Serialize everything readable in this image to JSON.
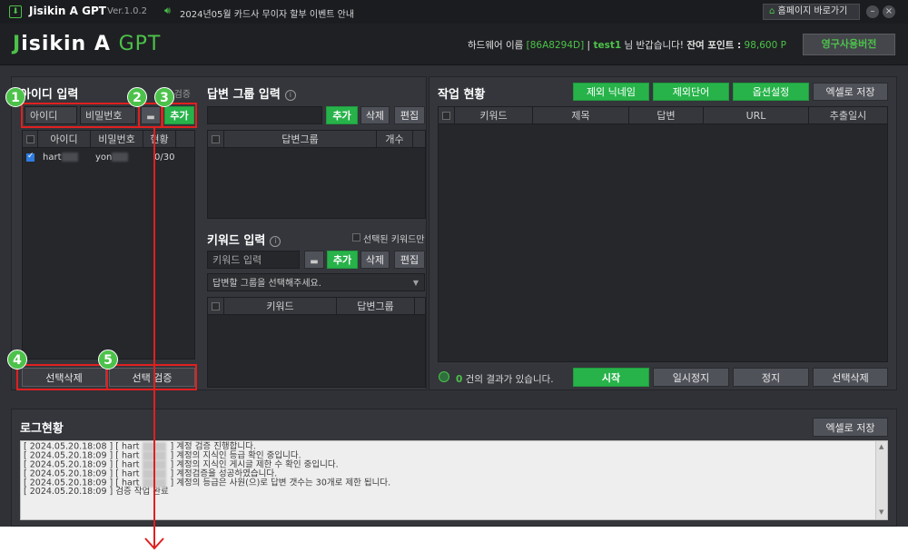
{
  "titlebar": {
    "app_name": "Jisikin A GPT",
    "version": "Ver.1.0.2",
    "notice": "2024년05월 카드사 무이자 할부 이벤트 안내",
    "home_button": "홈페이지 바로가기",
    "min": "–",
    "close": "×"
  },
  "header": {
    "logo_j": "J",
    "logo_rest": "isikin A",
    "logo_gpt": "GPT",
    "hw_label": "하드웨어 이름",
    "hw_id": "[86A8294D]",
    "sep": "|",
    "user": "test1",
    "greeting": "님 반갑습니다!",
    "points_label": "잔여 포인트 :",
    "points_value": "98,600 P",
    "license_button": "영구사용버전"
  },
  "id_panel": {
    "title": "아이디 입력",
    "hidden_label": "선택 검증",
    "id_placeholder": "아이디",
    "pw_placeholder": "비밀번호",
    "add": "추가",
    "columns": [
      "아이디",
      "비밀번호",
      "현황"
    ],
    "rows": [
      {
        "id": "hart",
        "pw": "yon",
        "status": "0/30",
        "checked": true
      }
    ],
    "delete_selected": "선택삭제",
    "verify_selected": "선택 검증"
  },
  "group_panel": {
    "title": "답변 그룹 입력",
    "add": "추가",
    "delete": "삭제",
    "edit": "편집",
    "columns": [
      "답변그룹",
      "개수"
    ]
  },
  "keyword_panel": {
    "title": "키워드 입력",
    "only_selected": "선택된 키워드만",
    "keyword_placeholder": "키워드 입력",
    "add": "추가",
    "delete": "삭제",
    "edit": "편집",
    "group_select": "답변할 그룹을 선택해주세요.",
    "columns": [
      "키워드",
      "답변그룹"
    ]
  },
  "work_panel": {
    "title": "작업 현황",
    "btn_exclude_nick": "제외 닉네임",
    "btn_exclude_word": "제외단어",
    "btn_options": "옵션설정",
    "btn_excel": "엑셀로 저장",
    "columns": [
      "키워드",
      "제목",
      "답변",
      "URL",
      "추출일시"
    ],
    "result_count": "0",
    "result_text": "건의 결과가 있습니다.",
    "btn_start": "시작",
    "btn_pause": "일시정지",
    "btn_stop": "정지",
    "btn_delete_selected": "선택삭제"
  },
  "log_panel": {
    "title": "로그현황",
    "btn_excel": "엑셀로 저장",
    "lines": [
      {
        "ts": "[ 2024.05.20.18:08 ] [ hart",
        "msg": "] 계정 검증 진행합니다."
      },
      {
        "ts": "[ 2024.05.20.18:09 ] [ hart",
        "msg": "] 계정의 지식인 등급 확인 중입니다."
      },
      {
        "ts": "[ 2024.05.20.18:09 ] [ hart",
        "msg": "] 계정의 지식인 게시글 제한 수 확인 중입니다."
      },
      {
        "ts": "[ 2024.05.20.18:09 ] [ hart",
        "msg": "] 계정검증을 성공하였습니다."
      },
      {
        "ts": "[ 2024.05.20.18:09 ] [ hart",
        "msg": "] 계정의 등급은 사원(으)로 답변 갯수는 30개로 제한 됩니다."
      },
      {
        "ts": "[ 2024.05.20.18:09 ] 검증 작업 완료",
        "msg": ""
      }
    ]
  },
  "annotations": [
    "1",
    "2",
    "3",
    "4",
    "5"
  ],
  "colors": {
    "accent_green": "#27b34a",
    "annotation_red": "#e02020",
    "badge_green": "#4cc24a"
  }
}
